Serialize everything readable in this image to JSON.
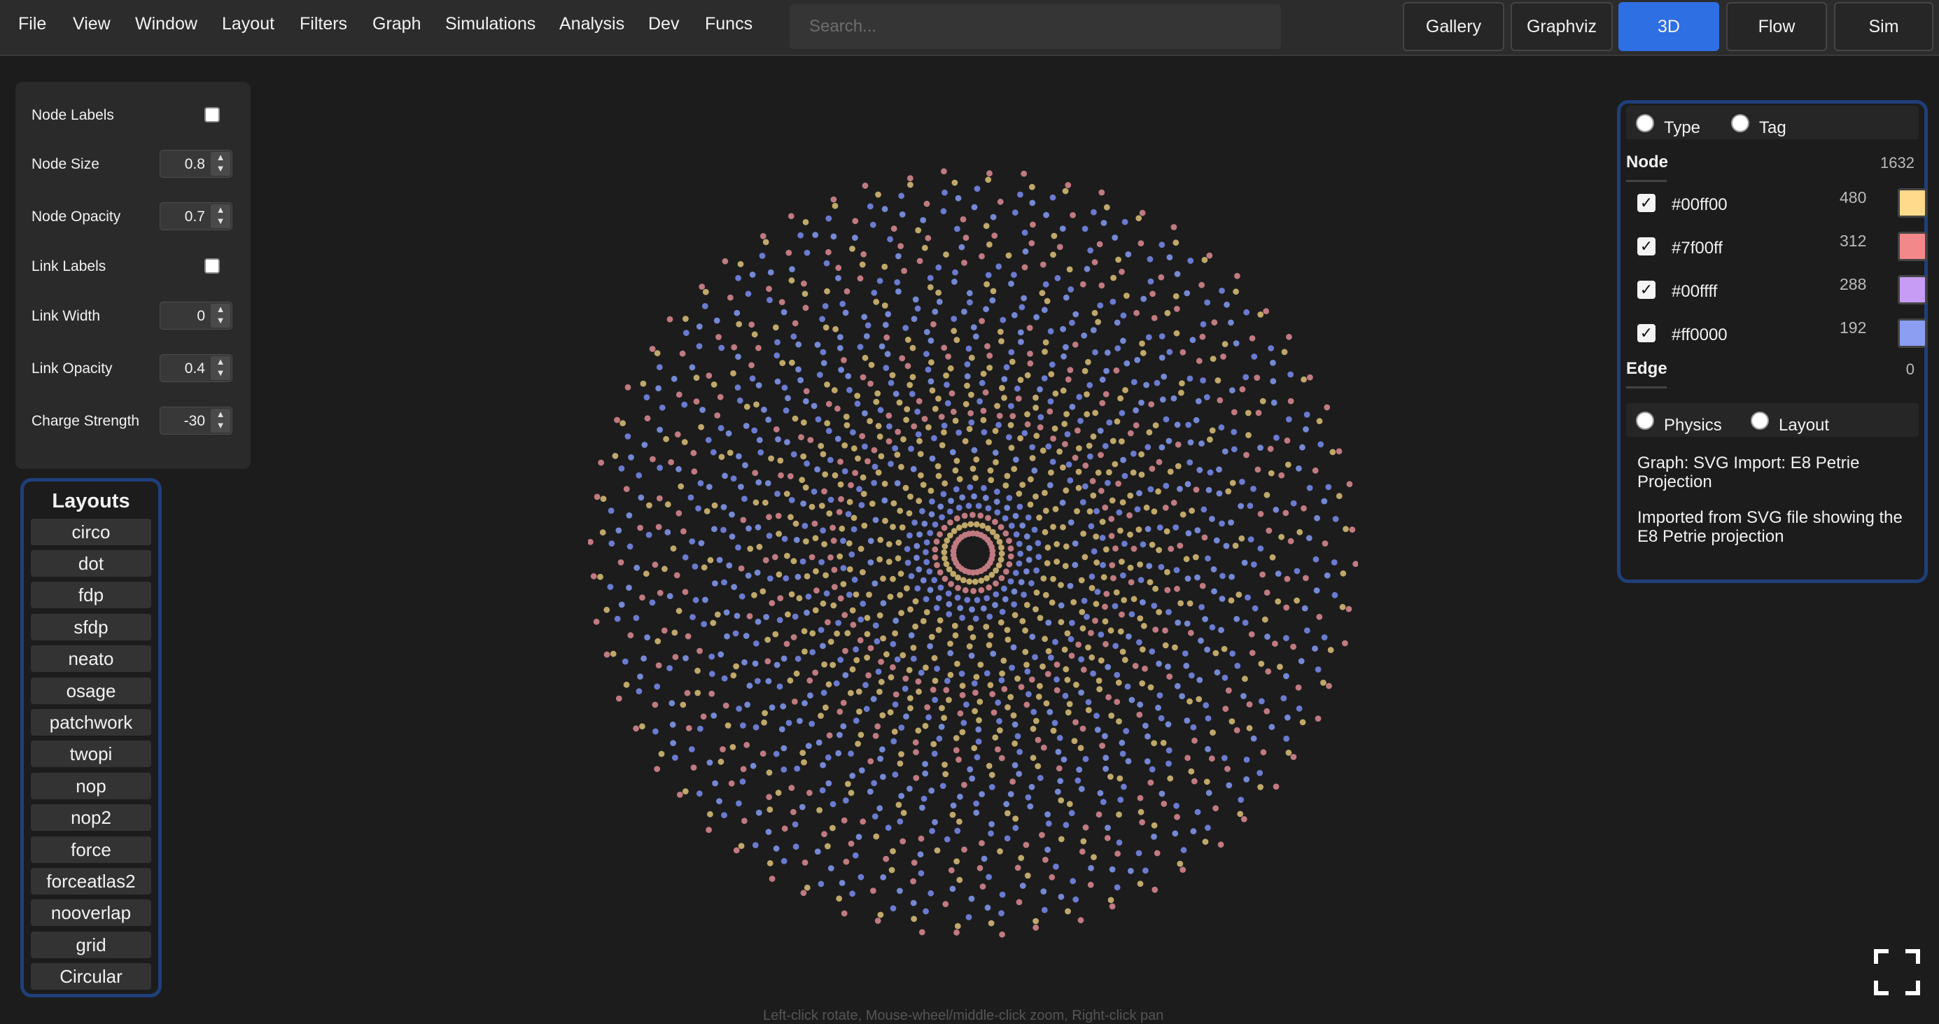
{
  "menu": [
    "File",
    "View",
    "Window",
    "Layout",
    "Filters",
    "Graph",
    "Simulations",
    "Analysis",
    "Dev",
    "Funcs"
  ],
  "search": {
    "placeholder": "Search..."
  },
  "nav": [
    "Gallery",
    "Graphviz",
    "3D",
    "Flow",
    "Sim"
  ],
  "nav_active": "3D",
  "settings": {
    "node_labels": "Node Labels",
    "node_size_label": "Node Size",
    "node_size": "0.8",
    "node_opacity_label": "Node Opacity",
    "node_opacity": "0.7",
    "link_labels": "Link Labels",
    "link_width_label": "Link Width",
    "link_width": "0",
    "link_opacity_label": "Link Opacity",
    "link_opacity": "0.4",
    "charge_label": "Charge Strength",
    "charge": "-30"
  },
  "layouts": {
    "title": "Layouts",
    "items": [
      "circo",
      "dot",
      "fdp",
      "sfdp",
      "neato",
      "osage",
      "patchwork",
      "twopi",
      "nop",
      "nop2",
      "force",
      "forceatlas2",
      "nooverlap",
      "grid",
      "Circular"
    ]
  },
  "panel": {
    "type_label": "Type",
    "tag_label": "Tag",
    "node_title": "Node",
    "node_count": "1632",
    "node_types": [
      {
        "name": "#00ff00",
        "count": "480",
        "color": "#ffd98c"
      },
      {
        "name": "#7f00ff",
        "count": "312",
        "color": "#f3888b"
      },
      {
        "name": "#00ffff",
        "count": "288",
        "color": "#c69cf4"
      },
      {
        "name": "#ff0000",
        "count": "192",
        "color": "#8c9ef2"
      }
    ],
    "edge_title": "Edge",
    "edge_count": "0",
    "physics_label": "Physics",
    "layout_label": "Layout",
    "graph_name": "Graph: SVG Import: E8 Petrie Projection",
    "graph_desc": "Imported from SVG file showing the E8 Petrie projection"
  },
  "hint": "Left-click rotate, Mouse-wheel/middle-click zoom, Right-click pan",
  "node_colors": [
    "#c0a86a",
    "#7488d4",
    "#c07a80",
    "#6a7bd0"
  ]
}
